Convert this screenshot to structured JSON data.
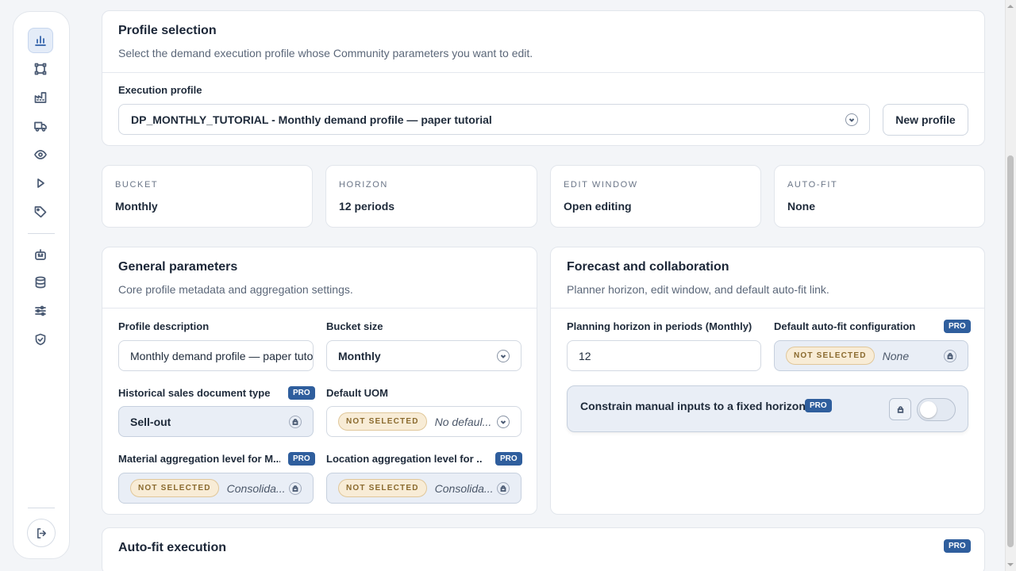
{
  "profile_card": {
    "title": "Profile selection",
    "subtitle": "Select the demand execution profile whose Community parameters you want to edit.",
    "field_label": "Execution profile",
    "selected": "DP_MONTHLY_TUTORIAL - Monthly demand profile — paper tutorial",
    "new_button": "New profile"
  },
  "stats": [
    {
      "label": "BUCKET",
      "value": "Monthly"
    },
    {
      "label": "HORIZON",
      "value": "12 periods"
    },
    {
      "label": "EDIT WINDOW",
      "value": "Open editing"
    },
    {
      "label": "AUTO-FIT",
      "value": "None"
    }
  ],
  "general": {
    "title": "General parameters",
    "subtitle": "Core profile metadata and aggregation settings.",
    "description_label": "Profile description",
    "description_value": "Monthly demand profile — paper tutorial",
    "bucket_label": "Bucket size",
    "bucket_value": "Monthly",
    "sales_doc_label": "Historical sales document type",
    "sales_doc_value": "Sell-out",
    "uom_label": "Default UOM",
    "uom_value": "No defaul...",
    "material_label": "Material aggregation level for M...",
    "material_value": "Consolida...",
    "location_label": "Location aggregation level for ...",
    "location_value": "Consolida..."
  },
  "forecast": {
    "title": "Forecast and collaboration",
    "subtitle": "Planner horizon, edit window, and default auto-fit link.",
    "horizon_label": "Planning horizon in periods (Monthly)",
    "horizon_value": "12",
    "autofit_label": "Default auto-fit configuration",
    "autofit_value": "None",
    "constrain_label": "Constrain manual inputs to a fixed horizon",
    "constrain_on": false
  },
  "autofit_exec": {
    "title": "Auto-fit execution"
  },
  "common": {
    "pro": "PRO",
    "not_selected": "NOT SELECTED"
  }
}
